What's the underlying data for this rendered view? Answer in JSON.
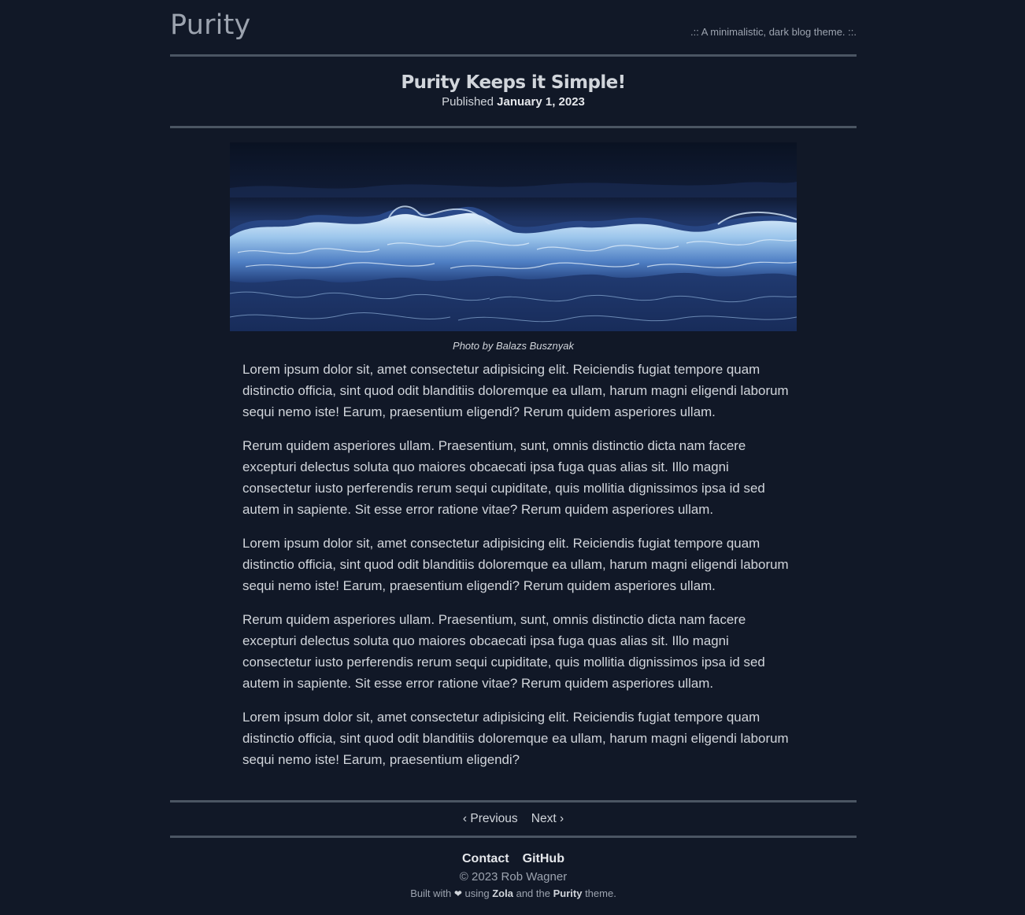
{
  "header": {
    "site_title": "Purity",
    "tagline": ".:: A minimalistic, dark blog theme. ::."
  },
  "post": {
    "title": "Purity Keeps it Simple!",
    "published_label": "Published",
    "date": "January 1, 2023",
    "image_caption": "Photo by Balazs Busznyak",
    "paragraphs": [
      "Lorem ipsum dolor sit, amet consectetur adipisicing elit. Reiciendis fugiat tempore quam distinctio officia, sint quod odit blanditiis doloremque ea ullam, harum magni eligendi laborum sequi nemo iste! Earum, praesentium eligendi? Rerum quidem asperiores ullam.",
      "Rerum quidem asperiores ullam. Praesentium, sunt, omnis distinctio dicta nam facere excepturi delectus soluta quo maiores obcaecati ipsa fuga quas alias sit. Illo magni consectetur iusto perferendis rerum sequi cupiditate, quis mollitia dignissimos ipsa id sed autem in sapiente. Sit esse error ratione vitae? Rerum quidem asperiores ullam.",
      "Lorem ipsum dolor sit, amet consectetur adipisicing elit. Reiciendis fugiat tempore quam distinctio officia, sint quod odit blanditiis doloremque ea ullam, harum magni eligendi laborum sequi nemo iste! Earum, praesentium eligendi? Rerum quidem asperiores ullam.",
      "Rerum quidem asperiores ullam. Praesentium, sunt, omnis distinctio dicta nam facere excepturi delectus soluta quo maiores obcaecati ipsa fuga quas alias sit. Illo magni consectetur iusto perferendis rerum sequi cupiditate, quis mollitia dignissimos ipsa id sed autem in sapiente. Sit esse error ratione vitae? Rerum quidem asperiores ullam.",
      "Lorem ipsum dolor sit, amet consectetur adipisicing elit. Reiciendis fugiat tempore quam distinctio officia, sint quod odit blanditiis doloremque ea ullam, harum magni eligendi laborum sequi nemo iste! Earum, praesentium eligendi?"
    ]
  },
  "pager": {
    "previous": "‹ Previous",
    "next": "Next ›"
  },
  "footer": {
    "links": [
      "Contact",
      "GitHub"
    ],
    "copyright": "© 2023 Rob Wagner",
    "built_prefix": "Built with",
    "built_using": "using",
    "engine": "Zola",
    "built_and": "and the",
    "theme_name": "Purity",
    "built_suffix": "theme.",
    "heart_icon": "heart-icon"
  },
  "colors": {
    "background": "#111827",
    "text": "#d1d5db",
    "muted_text": "#9ca3af",
    "rule": "#4b5563"
  }
}
